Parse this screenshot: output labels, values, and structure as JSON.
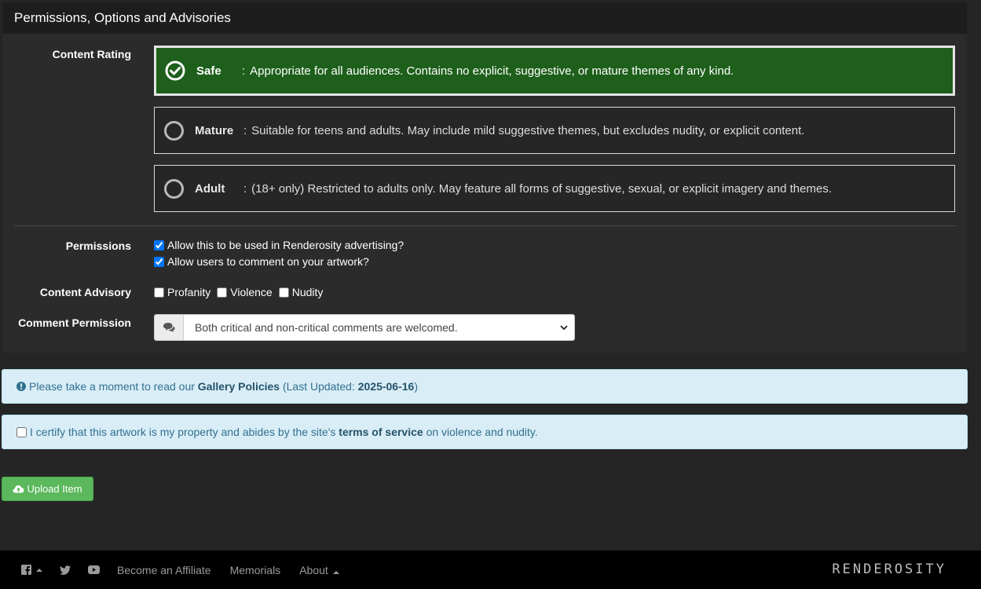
{
  "panel": {
    "title": "Permissions, Options and Advisories"
  },
  "content_rating": {
    "label": "Content Rating",
    "options": [
      {
        "name": "Safe",
        "sep": ":",
        "description": "Appropriate for all audiences. Contains no explicit, suggestive, or mature themes of any kind.",
        "selected": true
      },
      {
        "name": "Mature",
        "sep": ":",
        "description": "Suitable for teens and adults. May include mild suggestive themes, but excludes nudity, or explicit content.",
        "selected": false
      },
      {
        "name": "Adult",
        "sep": ":",
        "description": "(18+ only) Restricted to adults only. May feature all forms of suggestive, sexual, or explicit imagery and themes.",
        "selected": false
      }
    ],
    "selected_color": "#1e5f1b"
  },
  "permissions": {
    "label": "Permissions",
    "advertising": {
      "label": "Allow this to be used in Renderosity advertising?",
      "checked": true
    },
    "comments": {
      "label": "Allow users to comment on your artwork?",
      "checked": true
    }
  },
  "content_advisory": {
    "label": "Content Advisory",
    "items": [
      {
        "label": "Profanity",
        "checked": false
      },
      {
        "label": "Violence",
        "checked": false
      },
      {
        "label": "Nudity",
        "checked": false
      }
    ]
  },
  "comment_permission": {
    "label": "Comment Permission",
    "selected": "Both critical and non-critical comments are welcomed.",
    "icon": "comments-icon"
  },
  "policy_alert": {
    "prefix": "Please take a moment to read our",
    "link": "Gallery Policies",
    "updated_prefix": "(Last Updated:",
    "updated_date": "2025-06-16",
    "updated_suffix": ")"
  },
  "certify": {
    "prefix": "I certify that this artwork is my property and abides by the site's",
    "link": "terms of service",
    "suffix": "on violence and nudity.",
    "checked": false
  },
  "upload_button": {
    "label": "Upload Item",
    "color": "#5cb85c"
  },
  "footer": {
    "links": [
      "Become an Affiliate",
      "Memorials",
      "About"
    ],
    "brand": "RENDEROSITY"
  }
}
